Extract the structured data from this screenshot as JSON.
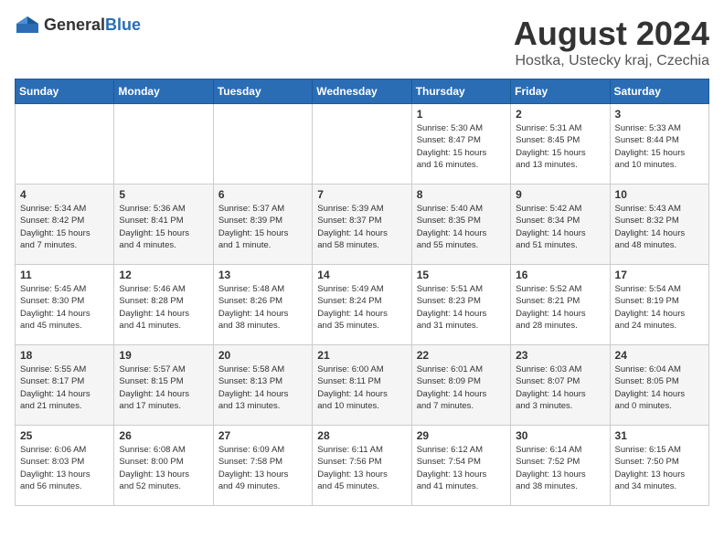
{
  "header": {
    "logo_general": "General",
    "logo_blue": "Blue",
    "month_title": "August 2024",
    "location": "Hostka, Ustecky kraj, Czechia"
  },
  "weekdays": [
    "Sunday",
    "Monday",
    "Tuesday",
    "Wednesday",
    "Thursday",
    "Friday",
    "Saturday"
  ],
  "weeks": [
    [
      {
        "day": "",
        "info": ""
      },
      {
        "day": "",
        "info": ""
      },
      {
        "day": "",
        "info": ""
      },
      {
        "day": "",
        "info": ""
      },
      {
        "day": "1",
        "info": "Sunrise: 5:30 AM\nSunset: 8:47 PM\nDaylight: 15 hours\nand 16 minutes."
      },
      {
        "day": "2",
        "info": "Sunrise: 5:31 AM\nSunset: 8:45 PM\nDaylight: 15 hours\nand 13 minutes."
      },
      {
        "day": "3",
        "info": "Sunrise: 5:33 AM\nSunset: 8:44 PM\nDaylight: 15 hours\nand 10 minutes."
      }
    ],
    [
      {
        "day": "4",
        "info": "Sunrise: 5:34 AM\nSunset: 8:42 PM\nDaylight: 15 hours\nand 7 minutes."
      },
      {
        "day": "5",
        "info": "Sunrise: 5:36 AM\nSunset: 8:41 PM\nDaylight: 15 hours\nand 4 minutes."
      },
      {
        "day": "6",
        "info": "Sunrise: 5:37 AM\nSunset: 8:39 PM\nDaylight: 15 hours\nand 1 minute."
      },
      {
        "day": "7",
        "info": "Sunrise: 5:39 AM\nSunset: 8:37 PM\nDaylight: 14 hours\nand 58 minutes."
      },
      {
        "day": "8",
        "info": "Sunrise: 5:40 AM\nSunset: 8:35 PM\nDaylight: 14 hours\nand 55 minutes."
      },
      {
        "day": "9",
        "info": "Sunrise: 5:42 AM\nSunset: 8:34 PM\nDaylight: 14 hours\nand 51 minutes."
      },
      {
        "day": "10",
        "info": "Sunrise: 5:43 AM\nSunset: 8:32 PM\nDaylight: 14 hours\nand 48 minutes."
      }
    ],
    [
      {
        "day": "11",
        "info": "Sunrise: 5:45 AM\nSunset: 8:30 PM\nDaylight: 14 hours\nand 45 minutes."
      },
      {
        "day": "12",
        "info": "Sunrise: 5:46 AM\nSunset: 8:28 PM\nDaylight: 14 hours\nand 41 minutes."
      },
      {
        "day": "13",
        "info": "Sunrise: 5:48 AM\nSunset: 8:26 PM\nDaylight: 14 hours\nand 38 minutes."
      },
      {
        "day": "14",
        "info": "Sunrise: 5:49 AM\nSunset: 8:24 PM\nDaylight: 14 hours\nand 35 minutes."
      },
      {
        "day": "15",
        "info": "Sunrise: 5:51 AM\nSunset: 8:23 PM\nDaylight: 14 hours\nand 31 minutes."
      },
      {
        "day": "16",
        "info": "Sunrise: 5:52 AM\nSunset: 8:21 PM\nDaylight: 14 hours\nand 28 minutes."
      },
      {
        "day": "17",
        "info": "Sunrise: 5:54 AM\nSunset: 8:19 PM\nDaylight: 14 hours\nand 24 minutes."
      }
    ],
    [
      {
        "day": "18",
        "info": "Sunrise: 5:55 AM\nSunset: 8:17 PM\nDaylight: 14 hours\nand 21 minutes."
      },
      {
        "day": "19",
        "info": "Sunrise: 5:57 AM\nSunset: 8:15 PM\nDaylight: 14 hours\nand 17 minutes."
      },
      {
        "day": "20",
        "info": "Sunrise: 5:58 AM\nSunset: 8:13 PM\nDaylight: 14 hours\nand 13 minutes."
      },
      {
        "day": "21",
        "info": "Sunrise: 6:00 AM\nSunset: 8:11 PM\nDaylight: 14 hours\nand 10 minutes."
      },
      {
        "day": "22",
        "info": "Sunrise: 6:01 AM\nSunset: 8:09 PM\nDaylight: 14 hours\nand 7 minutes."
      },
      {
        "day": "23",
        "info": "Sunrise: 6:03 AM\nSunset: 8:07 PM\nDaylight: 14 hours\nand 3 minutes."
      },
      {
        "day": "24",
        "info": "Sunrise: 6:04 AM\nSunset: 8:05 PM\nDaylight: 14 hours\nand 0 minutes."
      }
    ],
    [
      {
        "day": "25",
        "info": "Sunrise: 6:06 AM\nSunset: 8:03 PM\nDaylight: 13 hours\nand 56 minutes."
      },
      {
        "day": "26",
        "info": "Sunrise: 6:08 AM\nSunset: 8:00 PM\nDaylight: 13 hours\nand 52 minutes."
      },
      {
        "day": "27",
        "info": "Sunrise: 6:09 AM\nSunset: 7:58 PM\nDaylight: 13 hours\nand 49 minutes."
      },
      {
        "day": "28",
        "info": "Sunrise: 6:11 AM\nSunset: 7:56 PM\nDaylight: 13 hours\nand 45 minutes."
      },
      {
        "day": "29",
        "info": "Sunrise: 6:12 AM\nSunset: 7:54 PM\nDaylight: 13 hours\nand 41 minutes."
      },
      {
        "day": "30",
        "info": "Sunrise: 6:14 AM\nSunset: 7:52 PM\nDaylight: 13 hours\nand 38 minutes."
      },
      {
        "day": "31",
        "info": "Sunrise: 6:15 AM\nSunset: 7:50 PM\nDaylight: 13 hours\nand 34 minutes."
      }
    ]
  ]
}
